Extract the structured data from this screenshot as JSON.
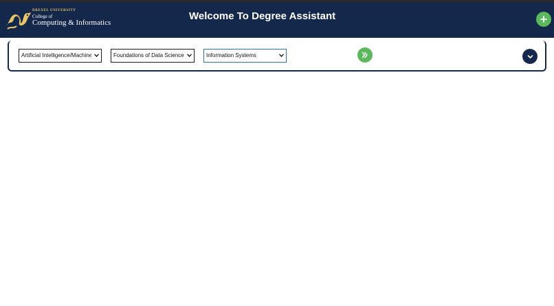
{
  "header": {
    "logo": {
      "university": "DREXEL UNIVERSITY",
      "college_line": "College of",
      "dept_line": "Computing & Informatics"
    },
    "title": "Welcome To Degree Assistant",
    "background_color": "#13284b"
  },
  "actions": {
    "add_icon": "plus-icon",
    "go_icon": "double-chevron-right-icon",
    "toggle_icon": "chevron-down-icon",
    "accent_color": "#5cb85c"
  },
  "selectors": [
    {
      "selected": "Artificial Intelligence/Machine Learning"
    },
    {
      "selected": "Foundations of Data Science"
    },
    {
      "selected": "Information Systems"
    }
  ]
}
